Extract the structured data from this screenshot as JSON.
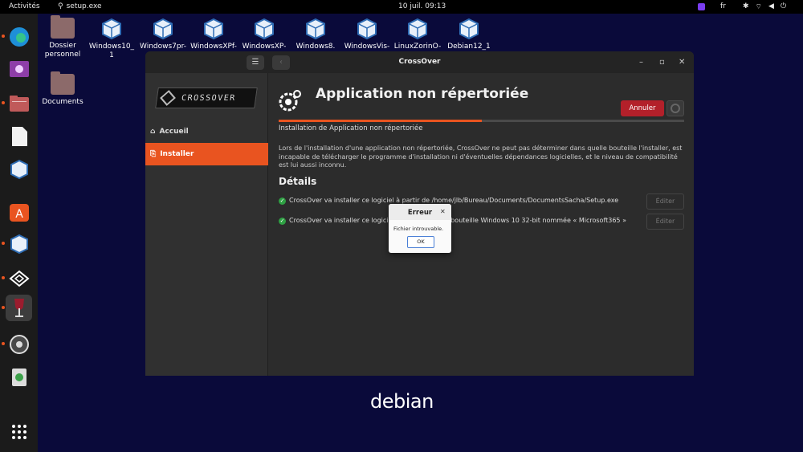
{
  "topbar": {
    "activities": "Activités",
    "app_name": "setup.exe",
    "clock": "10 juil.  09:13",
    "language": "fr"
  },
  "dock": {
    "items": [
      "edge-browser",
      "video-player",
      "files",
      "text-editor",
      "virtualbox",
      "software-center",
      "virtualbox-2",
      "crossover",
      "wine",
      "settings",
      "trash",
      "app-grid"
    ]
  },
  "desktop": {
    "icons": [
      {
        "label": "Dossier\npersonnel",
        "type": "home-folder"
      },
      {
        "label": "Documents",
        "type": "folder"
      },
      {
        "label": "Windows10_\n1",
        "type": "vbox"
      },
      {
        "label": "Windows7pr-\nc",
        "type": "vbox"
      },
      {
        "label": "WindowsXPf-",
        "type": "vbox"
      },
      {
        "label": "WindowsXP-",
        "type": "vbox"
      },
      {
        "label": "Windows8.",
        "type": "vbox"
      },
      {
        "label": "WindowsVis-",
        "type": "vbox"
      },
      {
        "label": "LinuxZorinO-",
        "type": "vbox"
      },
      {
        "label": "Debian12_1",
        "type": "vbox"
      }
    ],
    "wallpaper_text": "debian"
  },
  "window": {
    "title": "CrossOver",
    "logo_text": "CROSSOVER",
    "sidebar": [
      {
        "label": "Accueil",
        "icon": "home-icon"
      },
      {
        "label": "Installer",
        "icon": "install-icon"
      }
    ],
    "main": {
      "app_title": "Application non répertoriée",
      "cancel_label": "Annuler",
      "progress_fraction": 0.5,
      "install_label": "Installation de Application non répertoriée",
      "description": "Lors de l'installation d'une application non répertoriée, CrossOver ne peut pas déterminer dans quelle bouteille l'installer, est incapable de télécharger le programme d'installation ni d'éventuelles dépendances logicielles, et le niveau de compatibilité est lui aussi inconnu.",
      "details_title": "Détails",
      "details": [
        {
          "text": "CrossOver va installer ce logiciel à partir de /home/jlb/Bureau/Documents/DocumentsSacha/Setup.exe",
          "edit_label": "Éditer"
        },
        {
          "text": "CrossOver va installer ce logiciel dans la nouvelle bouteille Windows 10 32-bit nommée « Microsoft365 »",
          "edit_label": "Éditer"
        }
      ]
    }
  },
  "dialog": {
    "title": "Erreur",
    "message": "Fichier introuvable.",
    "ok_label": "OK"
  },
  "colors": {
    "accent": "#e95420",
    "cancel": "#b3202a",
    "wallpaper": "#0a0a3a"
  }
}
